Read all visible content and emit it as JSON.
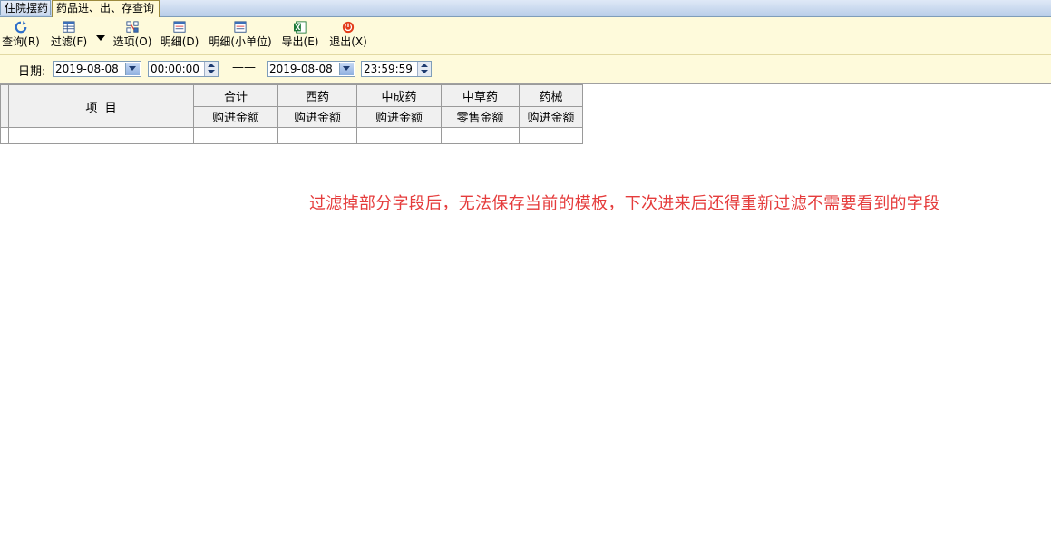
{
  "tabs": [
    {
      "label": "住院摆药",
      "active": false
    },
    {
      "label": "药品进、出、存查询",
      "active": true
    }
  ],
  "toolbar": {
    "query": "查询(R)",
    "filter": "过滤(F)",
    "options": "选项(O)",
    "detail": "明细(D)",
    "detail_small": "明细(小单位)",
    "export": "导出(E)",
    "exit": "退出(X)"
  },
  "daterow": {
    "label": "日期:",
    "start_date": "2019-08-08",
    "start_time": "00:00:00",
    "separator": "——",
    "end_date": "2019-08-08",
    "end_time": "23:59:59"
  },
  "grid": {
    "item_header": "项  目",
    "columns": [
      {
        "name": "合计",
        "sub": "购进金额"
      },
      {
        "name": "西药",
        "sub": "购进金额"
      },
      {
        "name": "中成药",
        "sub": "购进金额"
      },
      {
        "name": "中草药",
        "sub": "零售金额"
      },
      {
        "name": "药械",
        "sub": "购进金额"
      }
    ]
  },
  "note": "过滤掉部分字段后，无法保存当前的模板，下次进来后还得重新过滤不需要看到的字段",
  "colors": {
    "note": "#e53c3c",
    "toolbar_bg": "#fefadb",
    "tab_active_bg": "#fff9d6"
  }
}
